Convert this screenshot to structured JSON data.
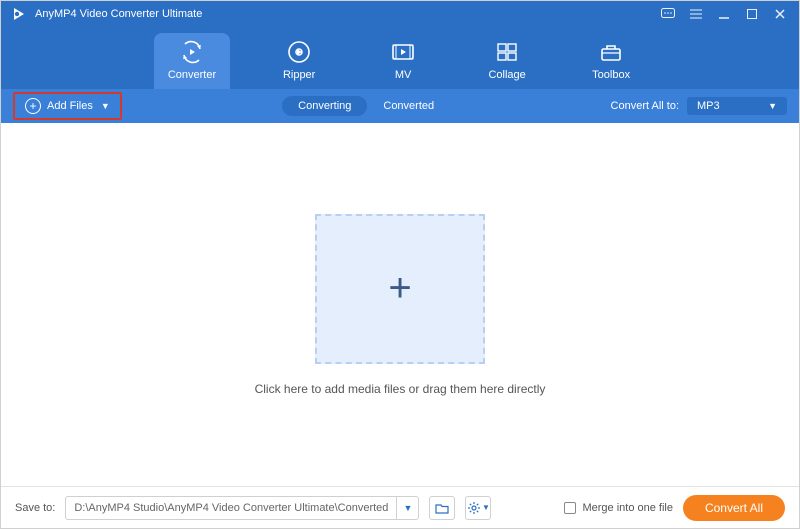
{
  "title": "AnyMP4 Video Converter Ultimate",
  "nav": {
    "converter": "Converter",
    "ripper": "Ripper",
    "mv": "MV",
    "collage": "Collage",
    "toolbox": "Toolbox"
  },
  "subbar": {
    "add_files": "Add Files",
    "converting": "Converting",
    "converted": "Converted",
    "convert_all_to_label": "Convert All to:",
    "convert_all_to_value": "MP3"
  },
  "work": {
    "hint": "Click here to add media files or drag them here directly"
  },
  "footer": {
    "save_to_label": "Save to:",
    "save_to_path": "D:\\AnyMP4 Studio\\AnyMP4 Video Converter Ultimate\\Converted",
    "merge_label": "Merge into one file",
    "convert_all_btn": "Convert All"
  }
}
